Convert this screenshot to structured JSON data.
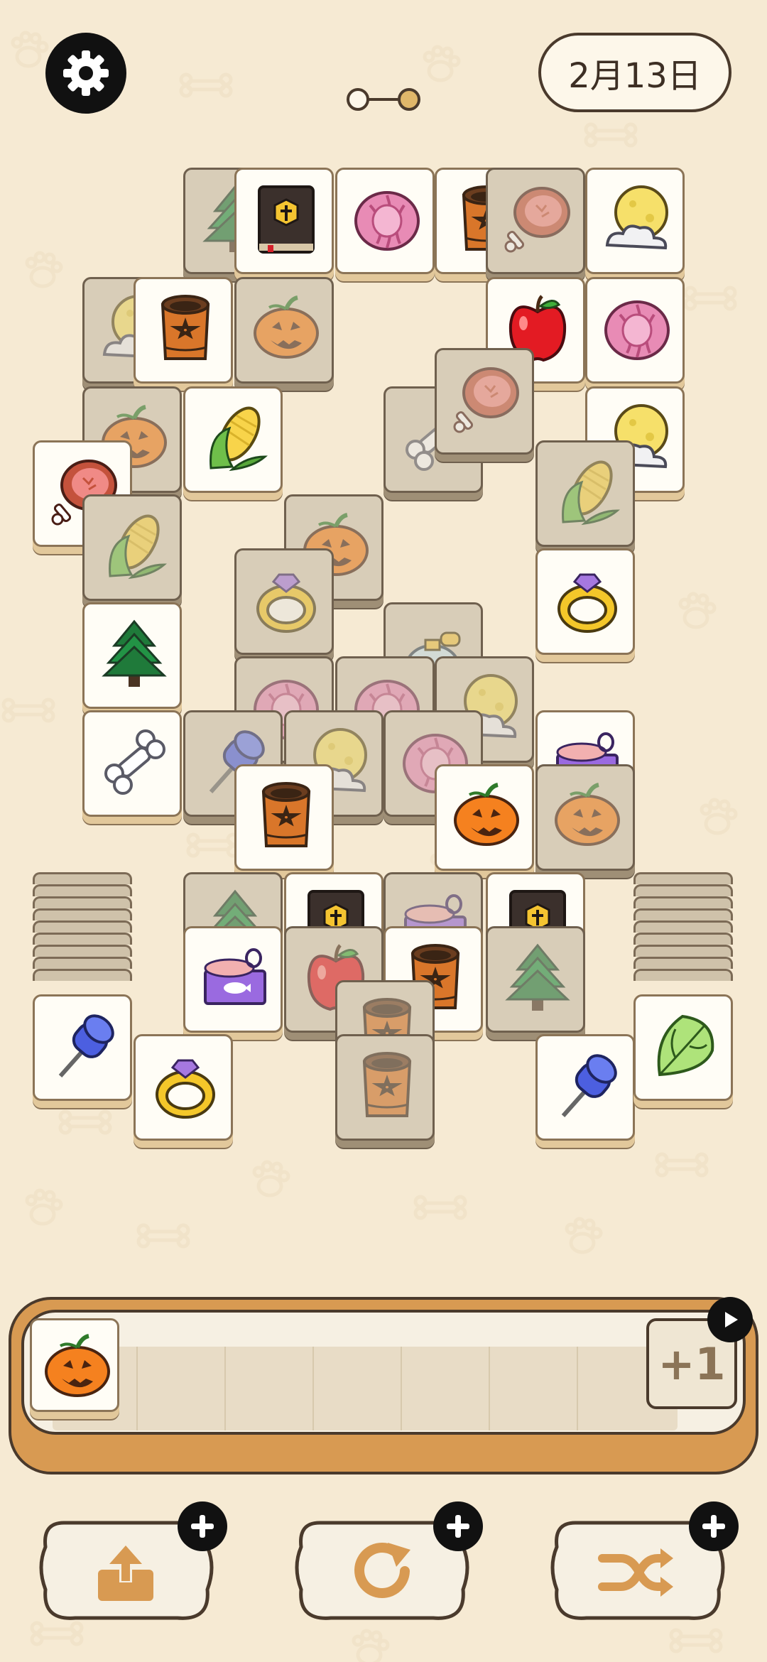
{
  "header": {
    "settings_icon": "gear-icon",
    "date_label": "2月13日",
    "progress": {
      "current_stage": 2,
      "total_stages": 2
    }
  },
  "board": {
    "tiles": [
      {
        "icon": "tree",
        "dim": true
      },
      {
        "icon": "book",
        "dim": false
      },
      {
        "icon": "cabbage",
        "dim": false
      },
      {
        "icon": "barrel",
        "dim": false
      },
      {
        "icon": "ham",
        "dim": true
      },
      {
        "icon": "moon",
        "dim": false
      },
      {
        "icon": "moon",
        "dim": true
      },
      {
        "icon": "barrel",
        "dim": false
      },
      {
        "icon": "pumpkin",
        "dim": true
      },
      {
        "icon": "apple",
        "dim": false
      },
      {
        "icon": "cabbage",
        "dim": false
      },
      {
        "icon": "pumpkin",
        "dim": true
      },
      {
        "icon": "corn",
        "dim": false
      },
      {
        "icon": "bone",
        "dim": true
      },
      {
        "icon": "ham",
        "dim": true
      },
      {
        "icon": "moon",
        "dim": false
      },
      {
        "icon": "ham",
        "dim": false
      },
      {
        "icon": "corn",
        "dim": true
      },
      {
        "icon": "pumpkin",
        "dim": true
      },
      {
        "icon": "corn",
        "dim": true
      },
      {
        "icon": "ring",
        "dim": true
      },
      {
        "icon": "ring",
        "dim": false
      },
      {
        "icon": "tree",
        "dim": false
      },
      {
        "icon": "perfume",
        "dim": true
      },
      {
        "icon": "cabbage",
        "dim": true
      },
      {
        "icon": "cabbage",
        "dim": true
      },
      {
        "icon": "moon",
        "dim": true
      },
      {
        "icon": "bone",
        "dim": false
      },
      {
        "icon": "pin",
        "dim": true
      },
      {
        "icon": "moon",
        "dim": true
      },
      {
        "icon": "cabbage",
        "dim": true
      },
      {
        "icon": "catfood",
        "dim": false
      },
      {
        "icon": "barrel",
        "dim": false
      },
      {
        "icon": "pumpkin",
        "dim": false
      },
      {
        "icon": "pumpkin",
        "dim": true
      },
      {
        "icon": "tree",
        "dim": true
      },
      {
        "icon": "book",
        "dim": false
      },
      {
        "icon": "catfood",
        "dim": true
      },
      {
        "icon": "book",
        "dim": false
      },
      {
        "icon": "catfood",
        "dim": false
      },
      {
        "icon": "apple",
        "dim": true
      },
      {
        "icon": "barrel",
        "dim": false
      },
      {
        "icon": "tree",
        "dim": true
      },
      {
        "icon": "barrel",
        "dim": true
      },
      {
        "icon": "barrel",
        "dim": true
      },
      {
        "icon": "pin",
        "dim": false
      },
      {
        "icon": "ring",
        "dim": false
      },
      {
        "icon": "pin",
        "dim": false
      },
      {
        "icon": "lettuce",
        "dim": false
      }
    ]
  },
  "tray": {
    "slot_count": 7,
    "tiles": [
      {
        "icon": "pumpkin"
      }
    ],
    "extra_slot_label": "+1",
    "play_icon": "play-icon"
  },
  "toolbar": {
    "tools": [
      {
        "name": "undo",
        "icon": "box-up-icon"
      },
      {
        "name": "refresh",
        "icon": "refresh-icon"
      },
      {
        "name": "shuffle",
        "icon": "shuffle-icon"
      }
    ]
  }
}
